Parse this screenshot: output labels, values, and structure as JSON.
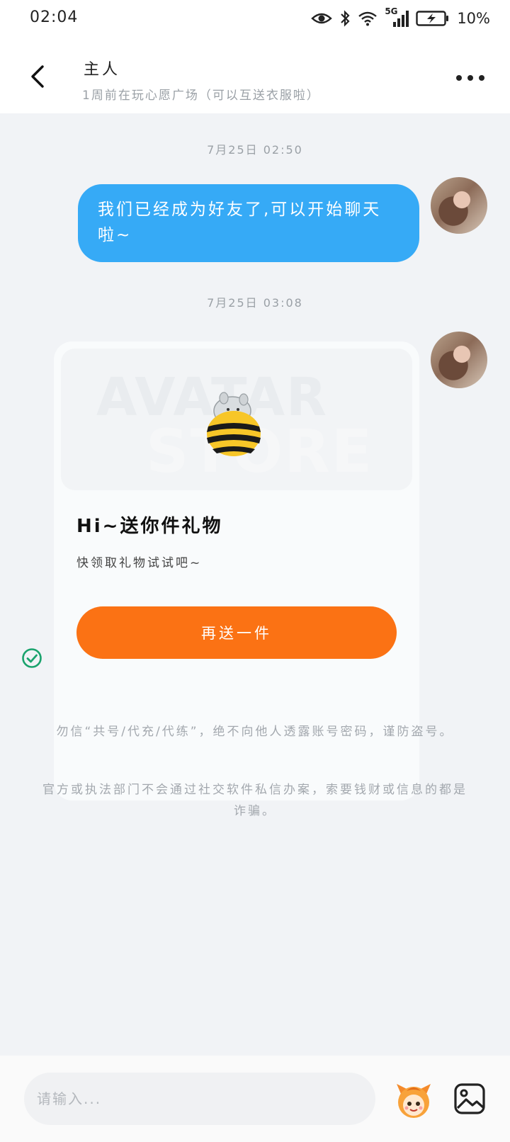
{
  "status_bar": {
    "time": "02:04",
    "network": "5G",
    "battery_percent": "10%",
    "icons": [
      "eye-icon",
      "bluetooth-icon",
      "wifi-icon",
      "signal-icon",
      "battery-charging-icon"
    ]
  },
  "header": {
    "title": "主人",
    "subtitle": "1周前在玩心愿广场（可以互送衣服啦）",
    "back_icon": "back-arrow-icon",
    "more_icon": "more-dots-icon"
  },
  "messages": [
    {
      "timestamp": "7月25日 02:50",
      "type": "text",
      "text": "我们已经成为好友了,可以开始聊天啦~"
    },
    {
      "timestamp": "7月25日 03:08",
      "type": "gift",
      "image_watermark_1": "AVATAR",
      "image_watermark_2": "STORE",
      "title": "Hi~送你件礼物",
      "description": "快领取礼物试试吧~",
      "button_label": "再送一件",
      "status_icon": "check-circle-icon"
    }
  ],
  "notices": [
    "勿信“共号/代充/代练”，绝不向他人透露账号密码，谨防盗号。",
    "官方或执法部门不会通过社交软件私信办案，索要钱财或信息的都是诈骗。"
  ],
  "input": {
    "placeholder": "请输入...",
    "value": ""
  },
  "colors": {
    "bubble_blue": "#36aaf6",
    "button_orange": "#fb7214",
    "chat_background": "#f1f3f6",
    "check_green": "#1aa36d"
  }
}
